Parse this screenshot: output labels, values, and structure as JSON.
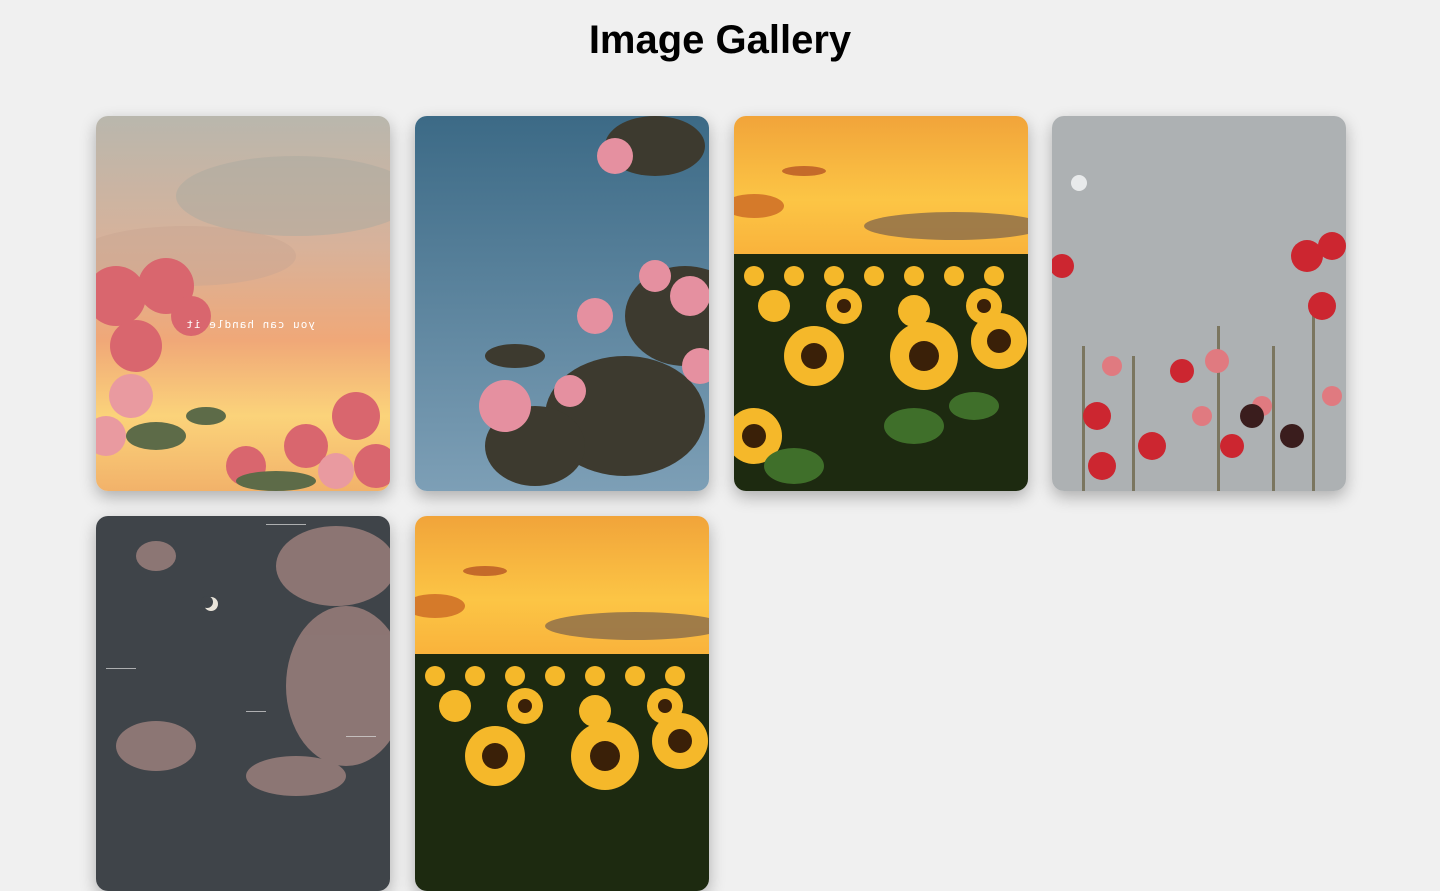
{
  "page": {
    "title": "Image Gallery"
  },
  "gallery": {
    "images": [
      {
        "subject": "pink roses against pastel sunset sky",
        "caption": "you can handle it"
      },
      {
        "subject": "pink flowers against blue sky"
      },
      {
        "subject": "sunflower field at sunset"
      },
      {
        "subject": "red hollyhocks against grey sky"
      },
      {
        "subject": "night clouds with crescent moon"
      },
      {
        "subject": "sunflower field at sunset"
      }
    ]
  },
  "colors": {
    "background": "#f0f0f0",
    "title": "#000000"
  }
}
